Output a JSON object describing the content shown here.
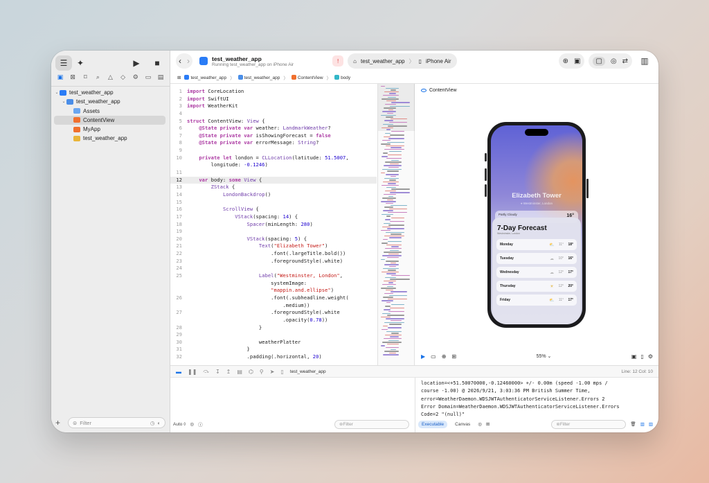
{
  "toolbar": {
    "project_title": "test_weather_app",
    "status": "Running test_weather_app on iPhone Air",
    "scheme_name": "test_weather_app",
    "device_name": "iPhone Air"
  },
  "jumpbar": [
    "test_weather_app",
    "test_weather_app",
    "ContentView",
    "body"
  ],
  "navigator": {
    "items": [
      {
        "label": "test_weather_app",
        "level": 0,
        "icon": "project"
      },
      {
        "label": "test_weather_app",
        "level": 1,
        "icon": "folder"
      },
      {
        "label": "Assets",
        "level": 2,
        "icon": "assets"
      },
      {
        "label": "ContentView",
        "level": 2,
        "icon": "swift"
      },
      {
        "label": "MyApp",
        "level": 2,
        "icon": "swift"
      },
      {
        "label": "test_weather_app",
        "level": 2,
        "icon": "entitlements"
      }
    ],
    "filter_placeholder": "Filter"
  },
  "editor": {
    "current_line": 12,
    "lines": [
      {
        "n": "1",
        "t": "import CoreLocation"
      },
      {
        "n": "2",
        "t": "import SwiftUI"
      },
      {
        "n": "3",
        "t": "import WeatherKit"
      },
      {
        "n": "4",
        "t": ""
      },
      {
        "n": "5",
        "t": "struct ContentView: View {"
      },
      {
        "n": "6",
        "t": "    @State private var weather: LandmarkWeather?"
      },
      {
        "n": "7",
        "t": "    @State private var isShowingForecast = false"
      },
      {
        "n": "8",
        "t": "    @State private var errorMessage: String?"
      },
      {
        "n": "9",
        "t": ""
      },
      {
        "n": "10",
        "t": "    private let london = CLLocation(latitude: 51.5007,"
      },
      {
        "n": "",
        "t": "        longitude: -0.1246)"
      },
      {
        "n": "11",
        "t": ""
      },
      {
        "n": "12",
        "t": "    var body: some View {"
      },
      {
        "n": "13",
        "t": "        ZStack {"
      },
      {
        "n": "14",
        "t": "            LondonBackdrop()"
      },
      {
        "n": "15",
        "t": ""
      },
      {
        "n": "16",
        "t": "            ScrollView {"
      },
      {
        "n": "17",
        "t": "                VStack(spacing: 14) {"
      },
      {
        "n": "18",
        "t": "                    Spacer(minLength: 280)"
      },
      {
        "n": "19",
        "t": ""
      },
      {
        "n": "20",
        "t": "                    VStack(spacing: 5) {"
      },
      {
        "n": "21",
        "t": "                        Text(\"Elizabeth Tower\")"
      },
      {
        "n": "22",
        "t": "                            .font(.largeTitle.bold())"
      },
      {
        "n": "23",
        "t": "                            .foregroundStyle(.white)"
      },
      {
        "n": "24",
        "t": ""
      },
      {
        "n": "25",
        "t": "                        Label(\"Westminster, London\","
      },
      {
        "n": "",
        "t": "                            systemImage:"
      },
      {
        "n": "",
        "t": "                            \"mappin.and.ellipse\")"
      },
      {
        "n": "26",
        "t": "                            .font(.subheadline.weight("
      },
      {
        "n": "",
        "t": "                                .medium))"
      },
      {
        "n": "27",
        "t": "                            .foregroundStyle(.white"
      },
      {
        "n": "",
        "t": "                                .opacity(0.78))"
      },
      {
        "n": "28",
        "t": "                        }"
      },
      {
        "n": "29",
        "t": ""
      },
      {
        "n": "30",
        "t": "                        weatherPlatter"
      },
      {
        "n": "31",
        "t": "                    }"
      },
      {
        "n": "32",
        "t": "                    .padding(.horizontal, 20)"
      }
    ]
  },
  "canvas": {
    "title": "ContentView",
    "zoom": "55%",
    "phone": {
      "title": "Elizabeth Tower",
      "subtitle": "Westminster, London",
      "platter_condition": "Partly Cloudy",
      "platter_temp": "16°",
      "sheet_title": "7-Day Forecast",
      "sheet_subtitle": "Westminster, London",
      "forecast": [
        {
          "day": "Monday",
          "lo": "11°",
          "hi": "18°",
          "icon": "partly-cloudy-icon"
        },
        {
          "day": "Tuesday",
          "lo": "10°",
          "hi": "16°",
          "icon": "cloud-icon"
        },
        {
          "day": "Wednesday",
          "lo": "12°",
          "hi": "17°",
          "icon": "cloud-icon"
        },
        {
          "day": "Thursday",
          "lo": "12°",
          "hi": "20°",
          "icon": "sun-icon"
        },
        {
          "day": "Friday",
          "lo": "11°",
          "hi": "17°",
          "icon": "partly-cloudy-icon"
        }
      ]
    }
  },
  "debug": {
    "target": "test_weather_app",
    "line_col": "Line: 12  Col: 10",
    "auto_label": "Auto ◊",
    "filter_placeholder": "Filter",
    "console_tabs": [
      "Executable",
      "Canvas"
    ],
    "console_text": "location=<+51.50070000,-0.12460000> +/- 0.00m (speed -1.00 mps /\ncourse -1.00) @ 2026/9/21, 3:03:36 PM British Summer Time,\nerror=WeatherDaemon.WDSJWTAuthenticatorServiceListener.Errors 2\nError Domain=WeatherDaemon.WDSJWTAuthenticatorServiceListener.Errors\nCode=2 \"(null)\""
  },
  "colors": {
    "accent": "#1a73e8",
    "keyword": "#ad3da4",
    "string": "#c41a16",
    "number": "#1c00cf",
    "type": "#703daa"
  }
}
